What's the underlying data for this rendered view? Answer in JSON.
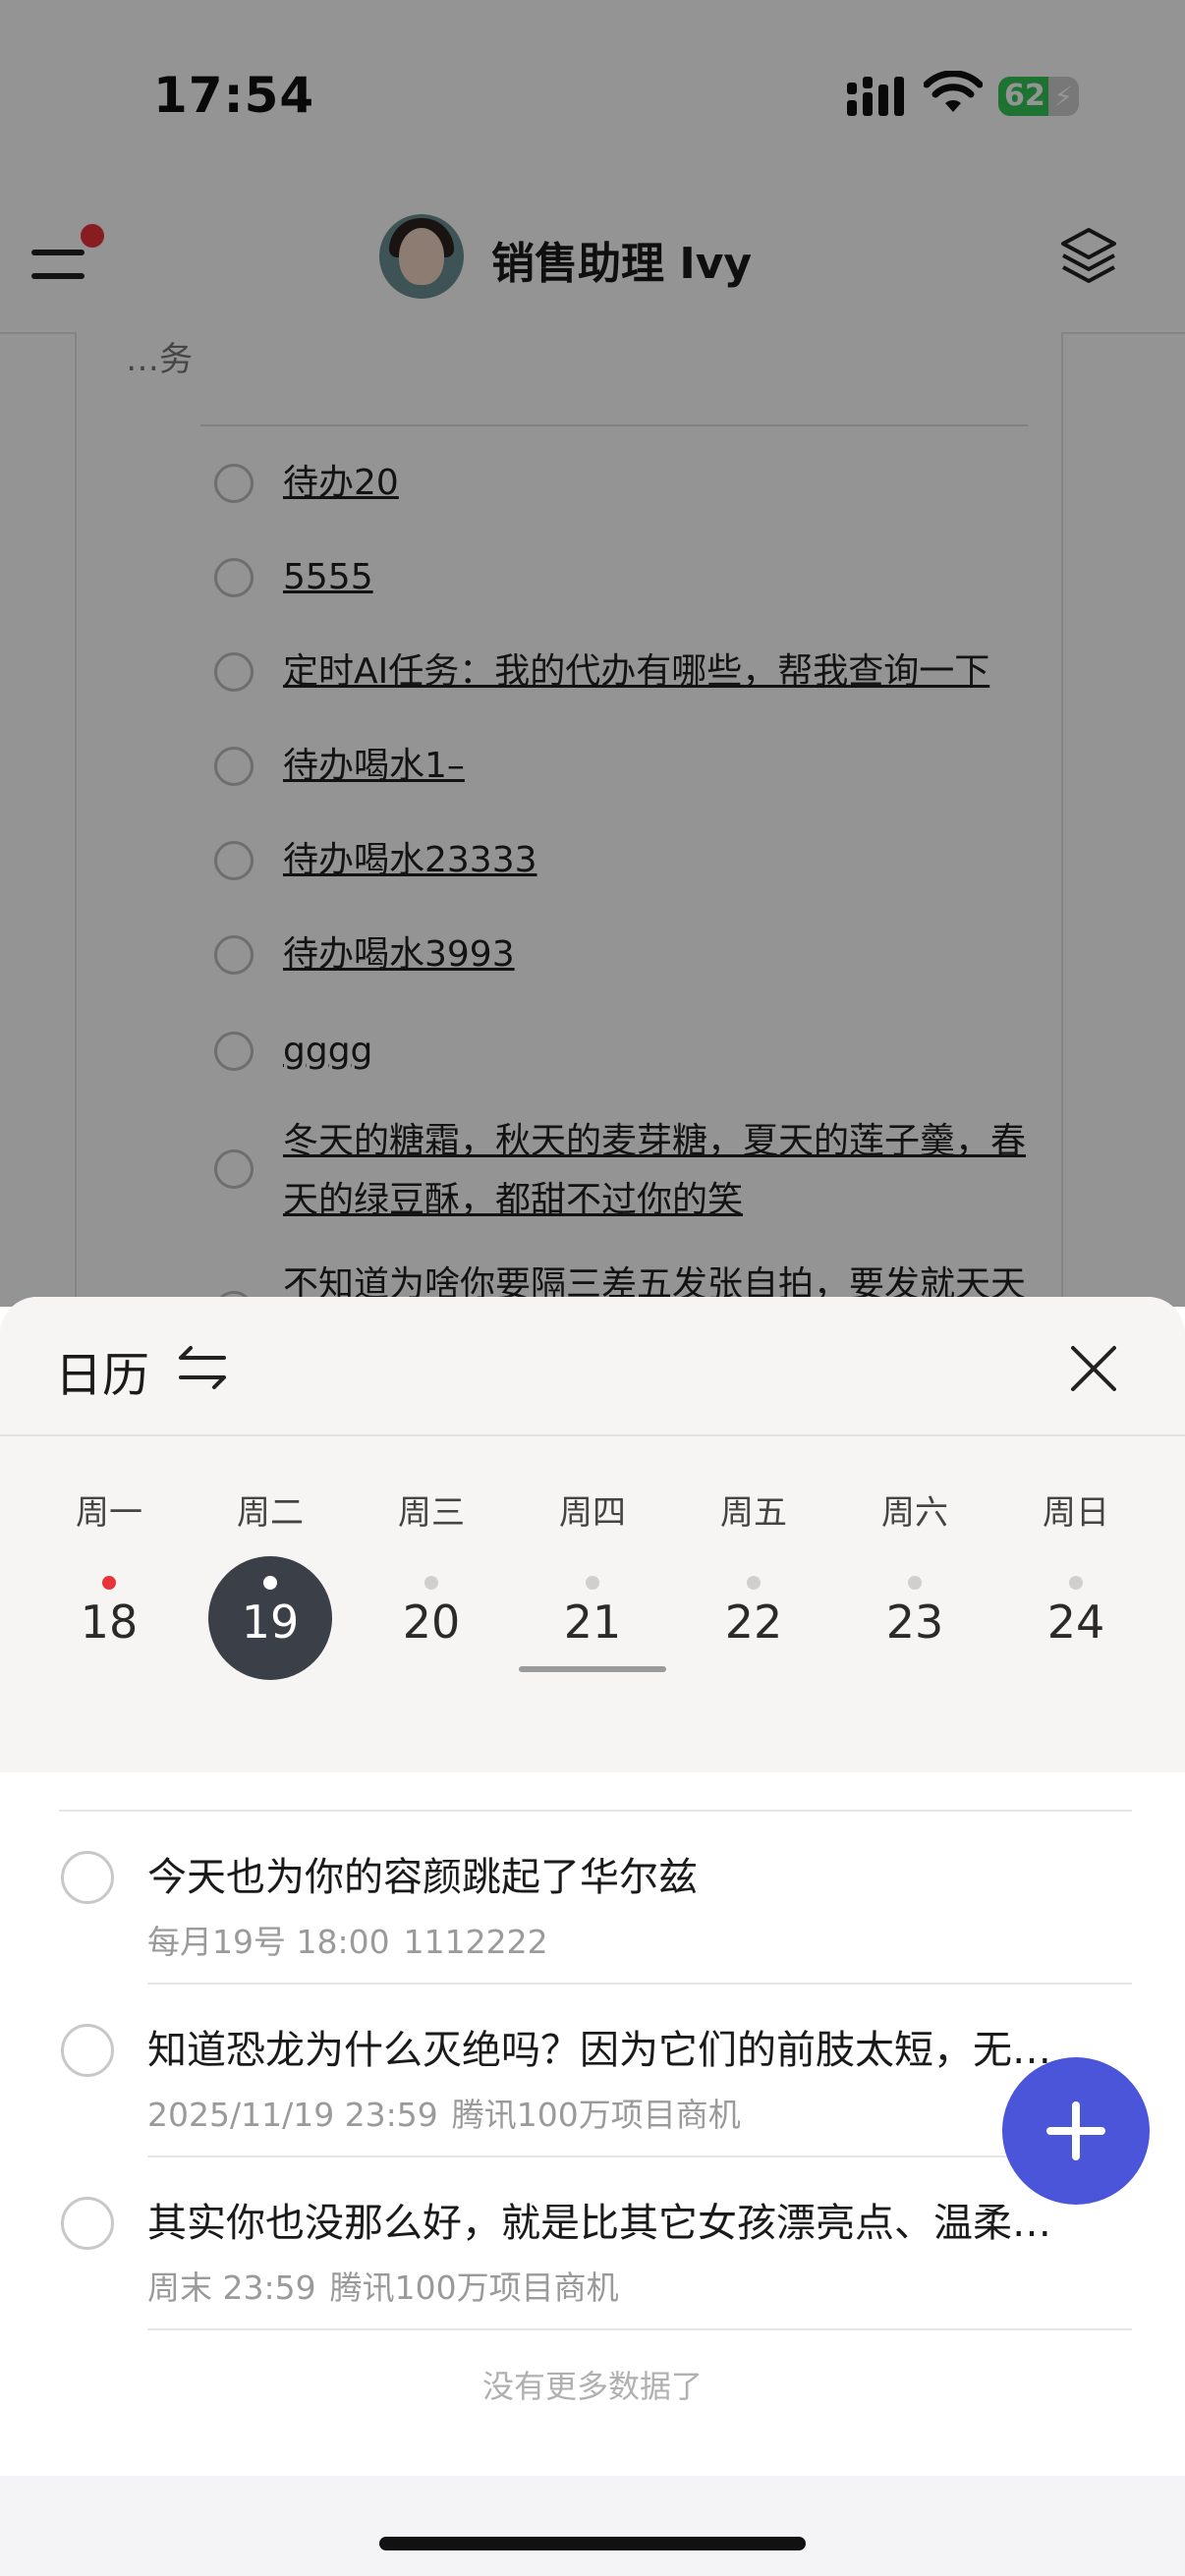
{
  "status_bar": {
    "time": "17:54",
    "battery": "62",
    "battery_level": 0.62
  },
  "header": {
    "assistant_name": "销售助理 Ivy"
  },
  "background_card": {
    "intro_text": "…务",
    "todos": [
      {
        "text": "待办20"
      },
      {
        "text": "5555"
      },
      {
        "text": "定时AI任务：我的代办有哪些，帮我查询一下"
      },
      {
        "text": "待办喝水1–"
      },
      {
        "text": "待办喝水23333"
      },
      {
        "text": "待办喝水3993"
      },
      {
        "text": "gggg"
      },
      {
        "text": "冬天的糖霜，秋天的麦芽糖，夏天的莲子羹，春天的绿豆酥，都甜不过你的笑"
      },
      {
        "text": "不知道为啥你要隔三差五发张自拍，要发就天天"
      }
    ]
  },
  "sheet": {
    "title": "日历",
    "week": [
      {
        "weekday": "周一",
        "date": "18",
        "dot": "red",
        "selected": false
      },
      {
        "weekday": "周二",
        "date": "19",
        "dot": "white",
        "selected": true
      },
      {
        "weekday": "周三",
        "date": "20",
        "dot": "gray",
        "selected": false
      },
      {
        "weekday": "周四",
        "date": "21",
        "dot": "gray",
        "selected": false
      },
      {
        "weekday": "周五",
        "date": "22",
        "dot": "gray",
        "selected": false
      },
      {
        "weekday": "周六",
        "date": "23",
        "dot": "gray",
        "selected": false
      },
      {
        "weekday": "周日",
        "date": "24",
        "dot": "gray",
        "selected": false
      }
    ],
    "tasks": [
      {
        "title": "今天也为你的容颜跳起了华尔兹",
        "time": "每月19号 18:00",
        "tag": "1112222"
      },
      {
        "title": "知道恐龙为什么灭绝吗？因为它们的前肢太短，无…",
        "time": "2025/11/19 23:59",
        "tag": "腾讯100万项目商机"
      },
      {
        "title": "其实你也没那么好，就是比其它女孩漂亮点、温柔…",
        "time": "周末 23:59",
        "tag": "腾讯100万项目商机"
      }
    ],
    "no_more_text": "没有更多数据了"
  },
  "colors": {
    "accent": "#4a55d9",
    "selected_date": "#3b3f48",
    "dot_red": "#e8333a"
  },
  "icons": [
    "menu-icon",
    "layers-icon",
    "swap-icon",
    "close-icon",
    "plus-icon",
    "wifi-icon",
    "signal-icon",
    "battery-icon"
  ]
}
